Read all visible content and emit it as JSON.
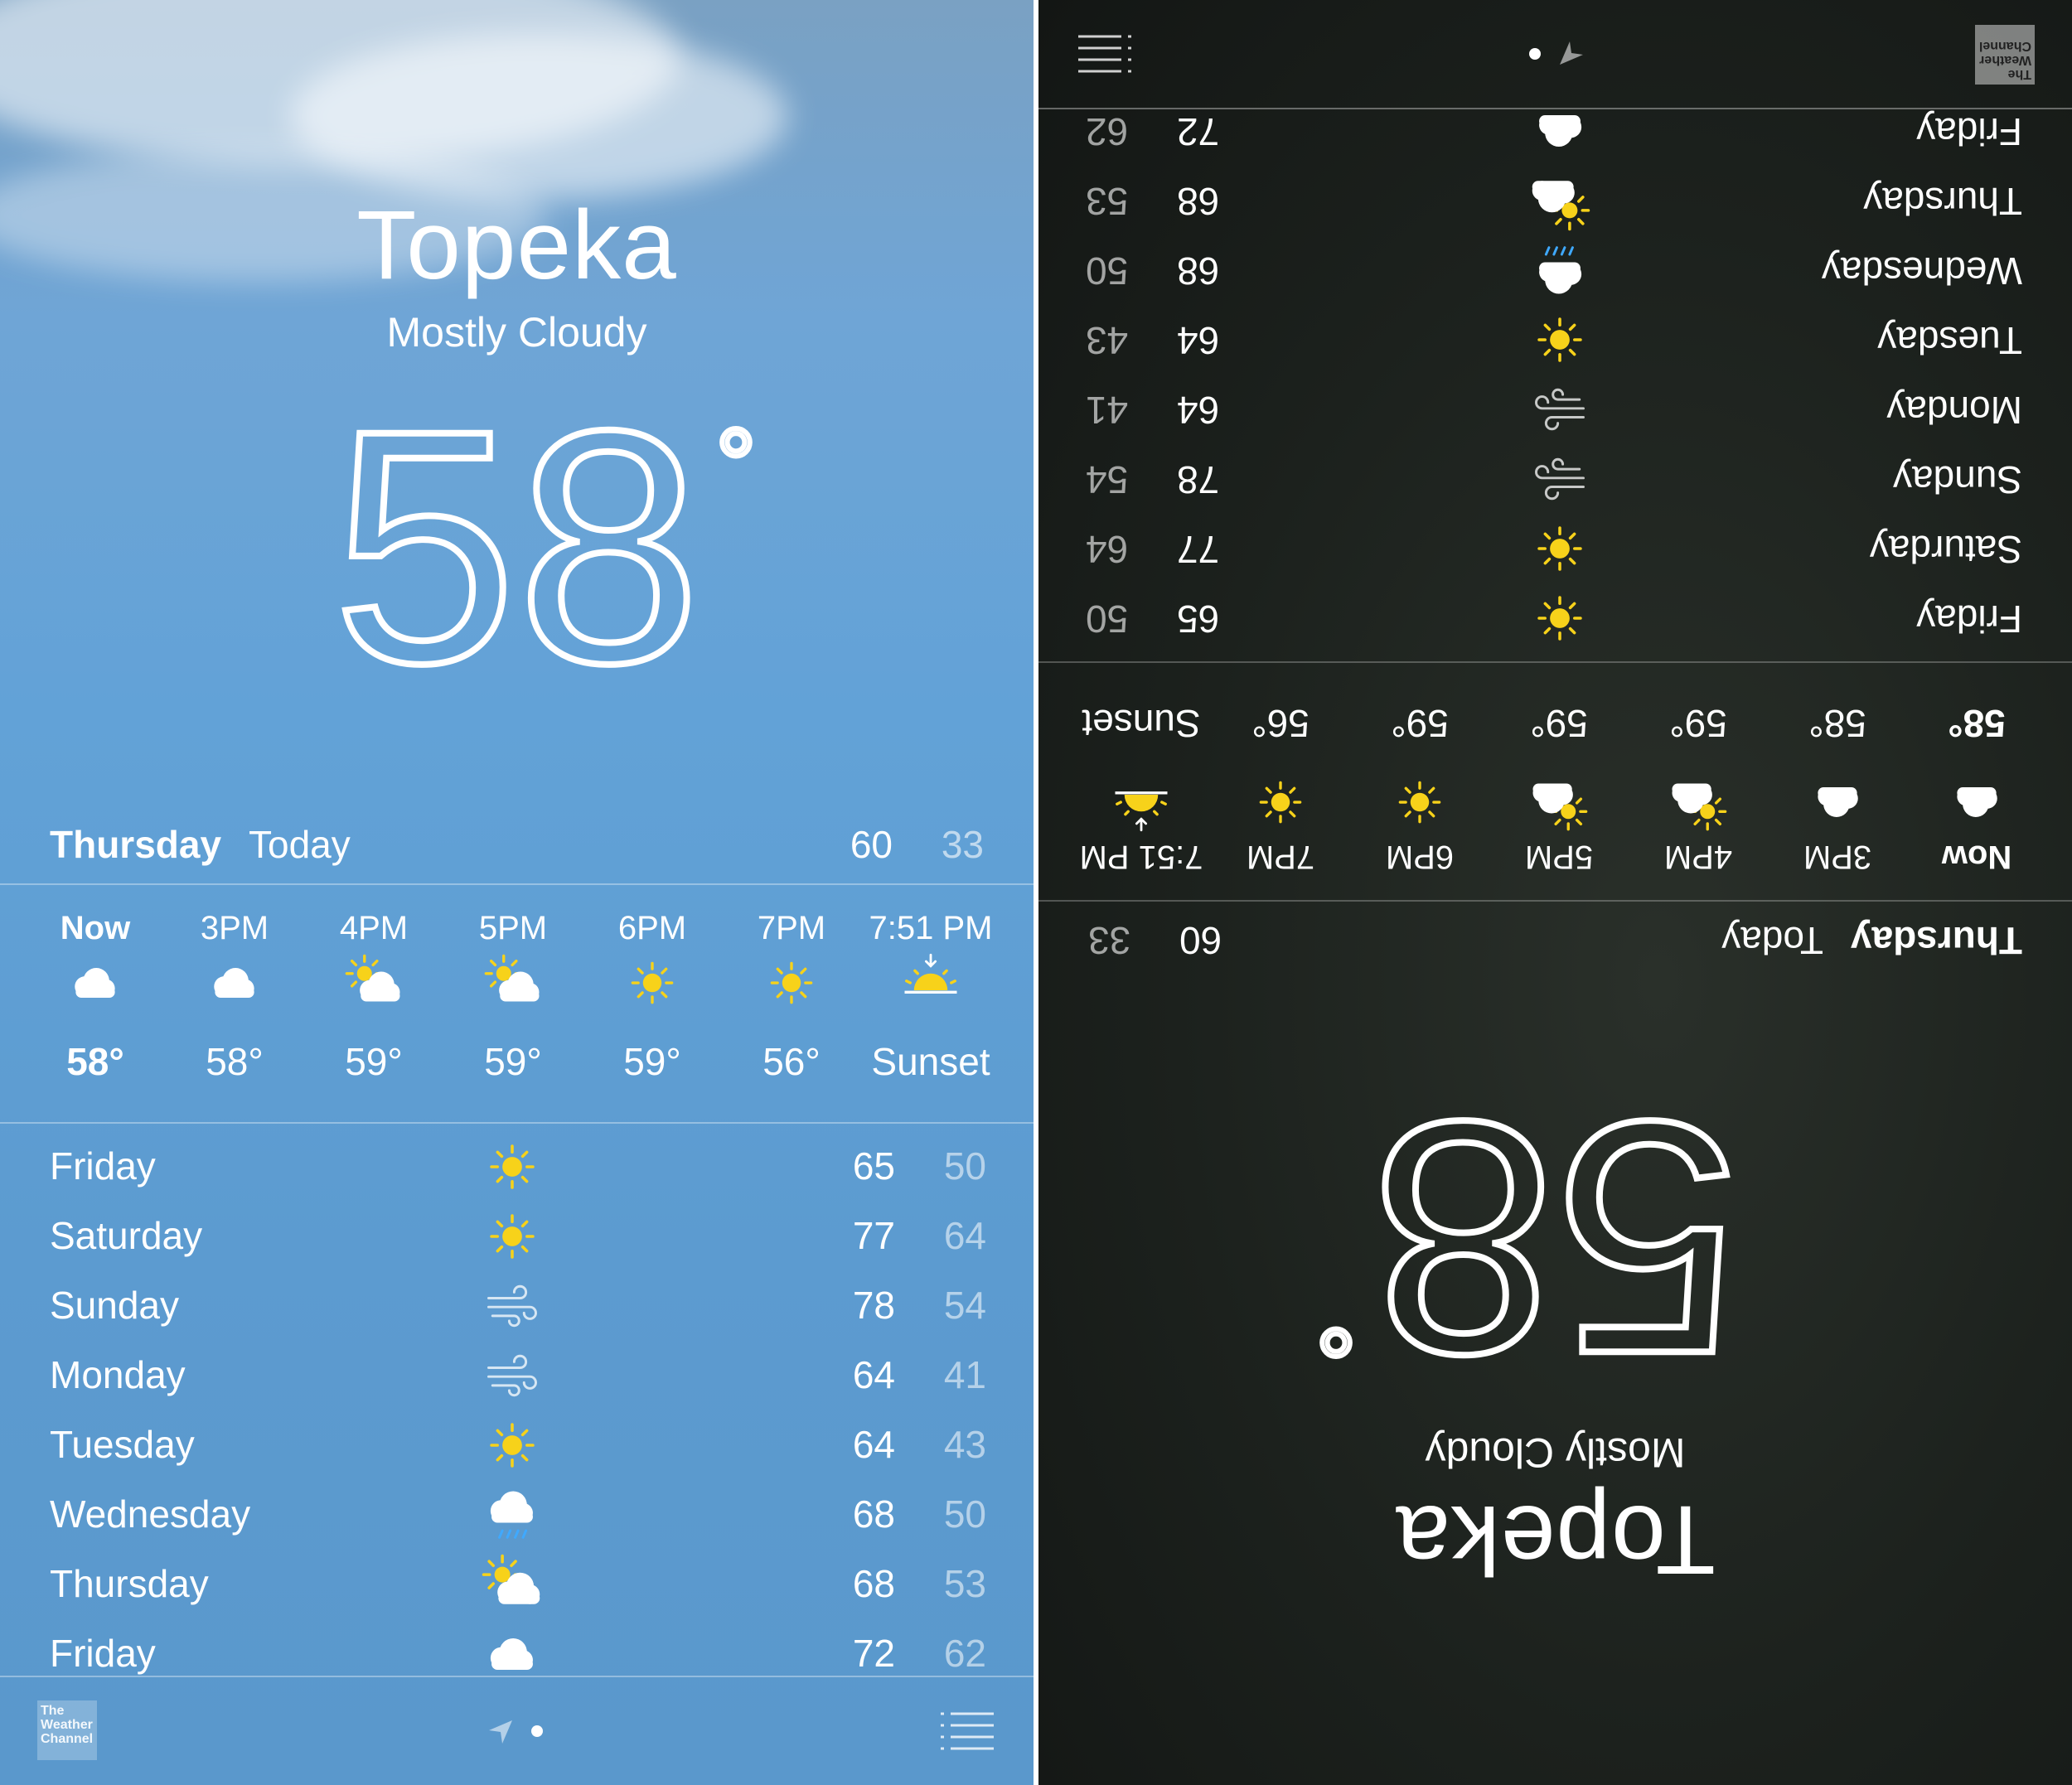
{
  "city": "Topeka",
  "condition": "Mostly Cloudy",
  "current_temp": "58",
  "degree_symbol": "°",
  "today": {
    "day": "Thursday",
    "label": "Today",
    "high": "60",
    "low": "33"
  },
  "hourly": [
    {
      "time": "Now",
      "icon": "cloud-icon",
      "temp": "58°"
    },
    {
      "time": "3PM",
      "icon": "cloud-icon",
      "temp": "58°"
    },
    {
      "time": "4PM",
      "icon": "partly-sunny-icon",
      "temp": "59°"
    },
    {
      "time": "5PM",
      "icon": "partly-sunny-icon",
      "temp": "59°"
    },
    {
      "time": "6PM",
      "icon": "sun-icon",
      "temp": "59°"
    },
    {
      "time": "7PM",
      "icon": "sun-icon",
      "temp": "56°"
    },
    {
      "time": "7:51 PM",
      "icon": "sunset-icon",
      "temp": "Sunset"
    }
  ],
  "daily": [
    {
      "day": "Friday",
      "icon": "sun-icon",
      "high": "65",
      "low": "50"
    },
    {
      "day": "Saturday",
      "icon": "sun-icon",
      "high": "77",
      "low": "64"
    },
    {
      "day": "Sunday",
      "icon": "wind-icon",
      "high": "78",
      "low": "54"
    },
    {
      "day": "Monday",
      "icon": "wind-icon",
      "high": "64",
      "low": "41"
    },
    {
      "day": "Tuesday",
      "icon": "sun-icon",
      "high": "64",
      "low": "43"
    },
    {
      "day": "Wednesday",
      "icon": "rain-icon",
      "high": "68",
      "low": "50"
    },
    {
      "day": "Thursday",
      "icon": "partly-sunny-icon",
      "high": "68",
      "low": "53"
    },
    {
      "day": "Friday",
      "icon": "cloud-icon",
      "high": "72",
      "low": "62"
    }
  ],
  "footer": {
    "brand": "The Weather Channel"
  },
  "colors": {
    "sun": "#f7d21a",
    "light_bg": "#5e9dd2",
    "dark_bg": "#1b201c"
  }
}
